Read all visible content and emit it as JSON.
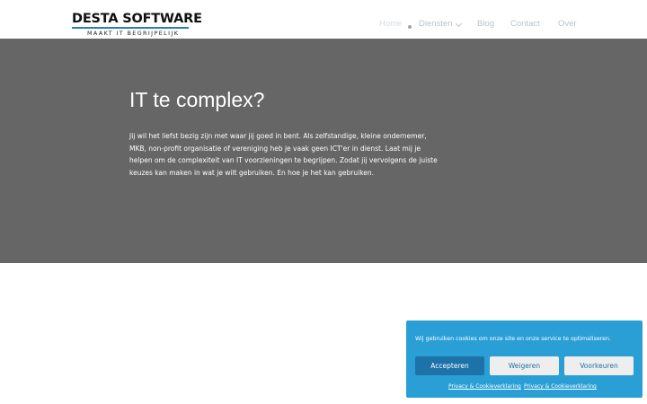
{
  "header": {
    "logo": {
      "name": "DESTA SOFTWARE",
      "tagline": "MAAKT IT BEGRIJPELIJK",
      "accent_color": "#2a7fc0"
    },
    "nav": [
      {
        "label": "Home",
        "active": true
      },
      {
        "label": "Diensten",
        "has_dropdown": true,
        "icon": "chevron-down-icon"
      },
      {
        "label": "Blog"
      },
      {
        "label": "Contact"
      },
      {
        "label": "Over"
      }
    ]
  },
  "hero": {
    "title": "IT te complex?",
    "paragraph_lines": [
      "Jij wil het liefst bezig zijn met waar jij goed in bent. Als zelfstandige, kleine ondernemer,",
      "MKB, non-profit organisatie of vereniging heb je vaak geen ICT'er in dienst.  Laat mij je",
      "helpen om de complexiteit van IT voorzieningen te begrijpen. Zodat jij vervolgens de juiste",
      "keuzes kan maken in wat je wilt gebruiken. En hoe je het kan gebruiken."
    ],
    "background_color": "#666666"
  },
  "cookie_banner": {
    "message": "Wij gebruiken cookies om onze site en onze service te optimaliseren.",
    "accept_label": "Accepteren",
    "deny_label": "Weigeren",
    "preferences_label": "Voorkeuren",
    "links": [
      "Privacy & Cookieverklaring",
      "Privacy & Cookieverklaring"
    ],
    "background_color": "#2a9fd6"
  }
}
